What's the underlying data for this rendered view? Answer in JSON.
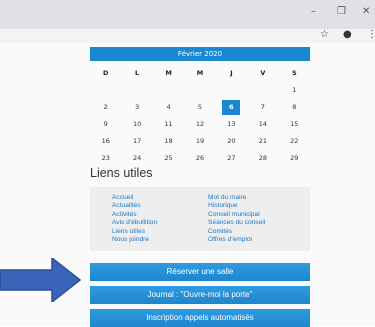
{
  "window": {
    "minimize_glyph": "–",
    "restore_glyph": "❐",
    "close_glyph": "✕"
  },
  "toolbar": {
    "star_glyph": "☆",
    "account_glyph": "●",
    "menu_glyph": "⋮"
  },
  "calendar": {
    "title": "Février 2020",
    "weekdays": [
      "D",
      "L",
      "M",
      "M",
      "J",
      "V",
      "S"
    ],
    "weeks": [
      [
        "",
        "",
        "",
        "",
        "",
        "",
        "1"
      ],
      [
        "2",
        "3",
        "4",
        "5",
        "6",
        "7",
        "8"
      ],
      [
        "9",
        "10",
        "11",
        "12",
        "13",
        "14",
        "15"
      ],
      [
        "16",
        "17",
        "18",
        "19",
        "20",
        "21",
        "22"
      ],
      [
        "23",
        "24",
        "25",
        "26",
        "27",
        "28",
        "29"
      ]
    ],
    "today": "6",
    "accent_color": "#1a88d0"
  },
  "useful_links": {
    "title": "Liens utiles",
    "left": [
      "Accueil",
      "Actualités",
      "Activités",
      "Avis d'ébullition",
      "Liens utiles",
      "Nous joindre"
    ],
    "right": [
      "Mot du maire",
      "Historique",
      "Conseil municipal",
      "Séances du conseil",
      "Comités",
      "Offres d'emploi"
    ]
  },
  "buttons": {
    "reserve": "Réserver une salle",
    "journal": "Journal : \"Ouvre-moi la porte\"",
    "inscription": "Inscription appels automatisés"
  },
  "arrow_color": "#3a64b8"
}
